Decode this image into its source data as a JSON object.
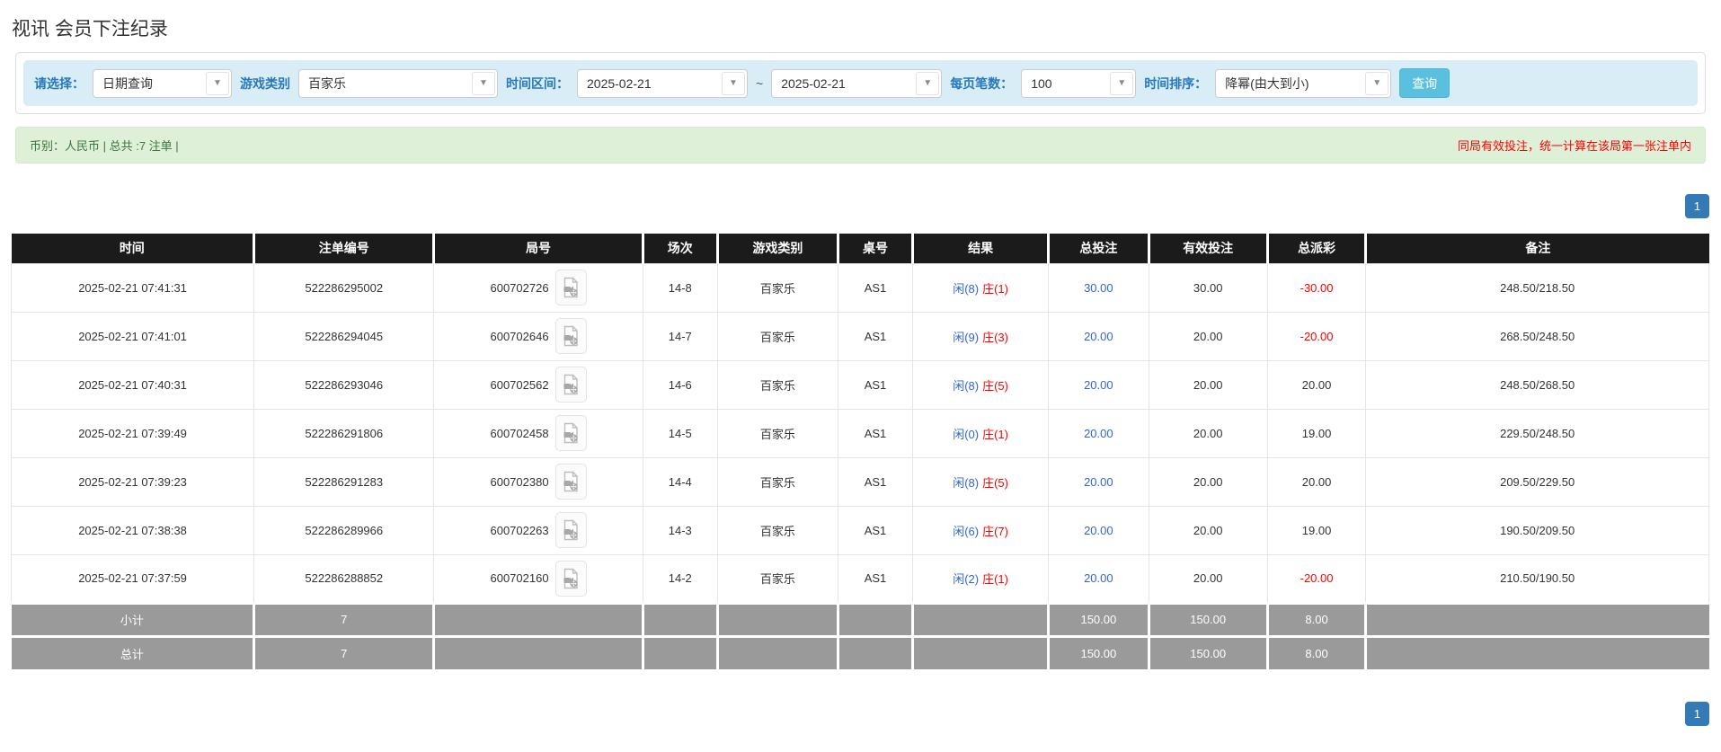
{
  "page_title": "视讯 会员下注纪录",
  "filters": {
    "select_label": "请选择：",
    "select_value": "日期查询",
    "game_type_label": "游戏类别",
    "game_type_value": "百家乐",
    "time_range_label": "时间区间：",
    "date_from": "2025-02-21",
    "range_separator": "~",
    "date_to": "2025-02-21",
    "page_size_label": "每页笔数：",
    "page_size_value": "100",
    "sort_label": "时间排序：",
    "sort_value": "降幂(由大到小)",
    "search_button": "查询"
  },
  "summary": {
    "left_text": "币别：人民币 | 总共 :7 注单 |",
    "right_notice": "同局有效投注，统一计算在该局第一张注单内"
  },
  "pagination": {
    "current_page": "1"
  },
  "table": {
    "headers": [
      "时间",
      "注单编号",
      "局号",
      "场次",
      "游戏类别",
      "桌号",
      "结果",
      "总投注",
      "有效投注",
      "总派彩",
      "备注"
    ],
    "rows": [
      {
        "time": "2025-02-21 07:41:31",
        "bet_id": "522286295002",
        "round_id": "600702726",
        "session": "14-8",
        "game": "百家乐",
        "table_id": "AS1",
        "result_player": "闲(8)",
        "result_banker": "庄(1)",
        "bet_total": "30.00",
        "valid_bet": "30.00",
        "payout": "-30.00",
        "remark": "248.50/218.50"
      },
      {
        "time": "2025-02-21 07:41:01",
        "bet_id": "522286294045",
        "round_id": "600702646",
        "session": "14-7",
        "game": "百家乐",
        "table_id": "AS1",
        "result_player": "闲(9)",
        "result_banker": "庄(3)",
        "bet_total": "20.00",
        "valid_bet": "20.00",
        "payout": "-20.00",
        "remark": "268.50/248.50"
      },
      {
        "time": "2025-02-21 07:40:31",
        "bet_id": "522286293046",
        "round_id": "600702562",
        "session": "14-6",
        "game": "百家乐",
        "table_id": "AS1",
        "result_player": "闲(8)",
        "result_banker": "庄(5)",
        "bet_total": "20.00",
        "valid_bet": "20.00",
        "payout": "20.00",
        "remark": "248.50/268.50"
      },
      {
        "time": "2025-02-21 07:39:49",
        "bet_id": "522286291806",
        "round_id": "600702458",
        "session": "14-5",
        "game": "百家乐",
        "table_id": "AS1",
        "result_player": "闲(0)",
        "result_banker": "庄(1)",
        "bet_total": "20.00",
        "valid_bet": "20.00",
        "payout": "19.00",
        "remark": "229.50/248.50"
      },
      {
        "time": "2025-02-21 07:39:23",
        "bet_id": "522286291283",
        "round_id": "600702380",
        "session": "14-4",
        "game": "百家乐",
        "table_id": "AS1",
        "result_player": "闲(8)",
        "result_banker": "庄(5)",
        "bet_total": "20.00",
        "valid_bet": "20.00",
        "payout": "20.00",
        "remark": "209.50/229.50"
      },
      {
        "time": "2025-02-21 07:38:38",
        "bet_id": "522286289966",
        "round_id": "600702263",
        "session": "14-3",
        "game": "百家乐",
        "table_id": "AS1",
        "result_player": "闲(6)",
        "result_banker": "庄(7)",
        "bet_total": "20.00",
        "valid_bet": "20.00",
        "payout": "19.00",
        "remark": "190.50/209.50"
      },
      {
        "time": "2025-02-21 07:37:59",
        "bet_id": "522286288852",
        "round_id": "600702160",
        "session": "14-2",
        "game": "百家乐",
        "table_id": "AS1",
        "result_player": "闲(2)",
        "result_banker": "庄(1)",
        "bet_total": "20.00",
        "valid_bet": "20.00",
        "payout": "-20.00",
        "remark": "210.50/190.50"
      }
    ],
    "subtotal": {
      "label": "小计",
      "count": "7",
      "bet_total": "150.00",
      "valid_bet": "150.00",
      "payout": "8.00"
    },
    "total": {
      "label": "总计",
      "count": "7",
      "bet_total": "150.00",
      "valid_bet": "150.00",
      "payout": "8.00"
    }
  },
  "colors": {
    "accent_info_blue": "#5bc0de",
    "pagination_blue": "#337ab7",
    "link_blue": "#3366cc",
    "negative_red": "#ff0000",
    "notice_red": "#ff0000",
    "summary_green_text": "#3c763d",
    "summary_green_bg": "#dff0d8",
    "filter_bar_bg": "#d9edf7",
    "header_black": "#1b1b1b",
    "footer_gray": "#9a9a9a"
  }
}
